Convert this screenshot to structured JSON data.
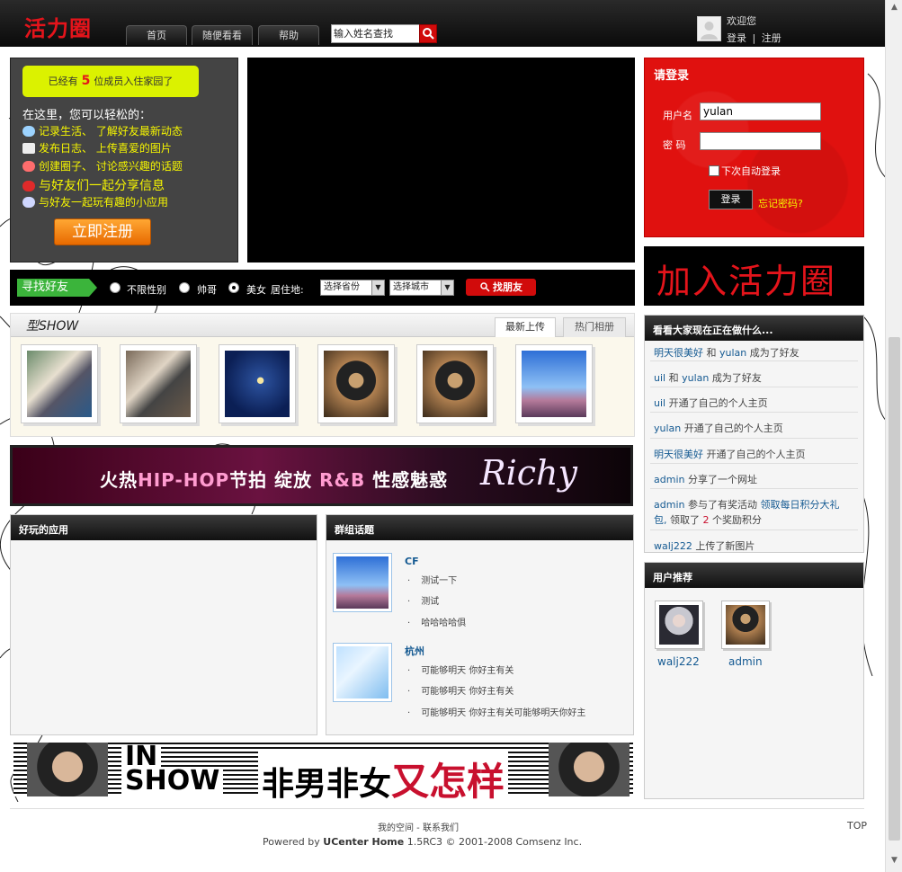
{
  "header": {
    "logo": "活力圈",
    "nav": [
      "首页",
      "随便看看",
      "帮助"
    ],
    "search_placeholder": "输入姓名查找",
    "welcome": "欢迎您",
    "login_link": "登录",
    "separator": "|",
    "register_link": "注册"
  },
  "intro": {
    "badge_prefix": "已经有",
    "member_count": "5",
    "badge_suffix": "位成员入住家园了",
    "title": "在这里，您可以轻松的：",
    "lines": [
      "记录生活、 了解好友最新动态",
      "发布日志、   上传喜爱的图片",
      "创建圈子、 讨论感兴趣的话题",
      "与好友们一起分享信息",
      "与好友一起玩有趣的小应用"
    ],
    "register_button": "立即注册"
  },
  "login": {
    "title": "请登录",
    "username_label": "用户名",
    "username_value": "yulan",
    "password_label": "密  码",
    "auto_login": "下次自动登录",
    "submit": "登录",
    "forgot": "忘记密码?"
  },
  "join_banner": "加入活力圈",
  "find_friends": {
    "label": "寻找好友",
    "gender_options": [
      "不限性别",
      "帅哥",
      "美女"
    ],
    "selected_gender": "美女",
    "residence_label": "居住地:",
    "province_select": "选择省份",
    "city_select": "选择城市",
    "button": "找朋友"
  },
  "show": {
    "title": "型SHOW",
    "tabs": [
      "最新上传",
      "热门相册"
    ]
  },
  "hiphop_banner": {
    "text_a": "火热",
    "tag_a": "HIP-HOP",
    "text_b": "节拍   绽放",
    "tag_b": "R&B",
    "text_c": "性感魅惑",
    "script": "Richy"
  },
  "apps_box": {
    "title": "好玩的应用"
  },
  "topics_box": {
    "title": "群组话题",
    "groups": [
      {
        "name": "CF",
        "items": [
          "测试一下",
          "测试",
          "哈哈哈哈俱"
        ]
      },
      {
        "name": "杭州",
        "items": [
          "可能够明天 你好主有关",
          "可能够明天 你好主有关",
          "可能够明天 你好主有关可能够明天你好主"
        ]
      }
    ]
  },
  "inshow_banner": {
    "in": "IN",
    "show": "SHOW",
    "text": "非男非女",
    "red": "又怎样"
  },
  "feed": {
    "title": "看看大家现在正在做什么...",
    "items": [
      {
        "user": "明天很美好",
        "mid": "和",
        "user2": "yulan",
        "text": "成为了好友"
      },
      {
        "user": "uil",
        "mid": "和",
        "user2": "yulan",
        "text": "成为了好友"
      },
      {
        "user": "uil",
        "text": "开通了自己的个人主页"
      },
      {
        "user": "yulan",
        "text": "开通了自己的个人主页"
      },
      {
        "user": "明天很美好",
        "text": "开通了自己的个人主页"
      },
      {
        "user": "admin",
        "text": "分享了一个网址"
      },
      {
        "user": "admin",
        "text": "参与了有奖活动",
        "link": "领取每日积分大礼",
        "line2_link": "包,",
        "line2_text": "领取了",
        "count": "2",
        "line2_tail": "个奖励积分"
      },
      {
        "user": "walj222",
        "text": "上传了新图片"
      }
    ]
  },
  "recommend": {
    "title": "用户推荐",
    "users": [
      "walj222",
      "admin"
    ]
  },
  "footer": {
    "links": "我的空间 - 联系我们",
    "top": "TOP",
    "powered_prefix": "Powered by",
    "product": "UCenter Home",
    "version": "1.5RC3 © 2001-2008 Comsenz Inc."
  }
}
